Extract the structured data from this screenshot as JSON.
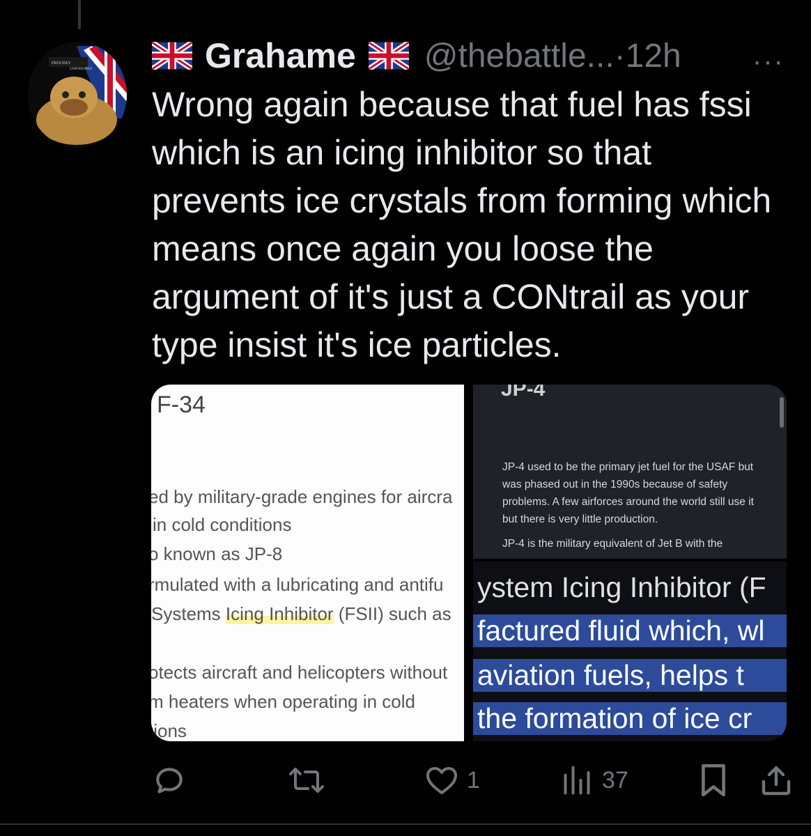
{
  "tweet": {
    "name": "Grahame",
    "handle": "@thebattle...",
    "separator": "·",
    "time": "12h",
    "more_label": "···",
    "text": "Wrong again because that fuel has fssi which is an icing inhibitor so that prevents ice crystals from forming which means once again you loose the argument of it's just a CONtrail as your type insist it's ice particles."
  },
  "avatar": {
    "top_text": "PROUDLY",
    "sub_text": "UNPOISONED"
  },
  "media": {
    "left": {
      "title": "F-34",
      "lines": [
        "ed by military-grade engines for aircra",
        "in cold conditions",
        "o known as JP-8",
        "rmulated with a lubricating and antifu",
        "Systems ",
        "Icing Inhibitor",
        " (FSII) such as",
        "otects aircraft and helicopters without",
        "m heaters when operating in cold",
        "tions"
      ]
    },
    "right_top": {
      "title": "JP-4",
      "para1": "JP-4 used to be the primary jet fuel for the USAF but was phased out in the 1990s because of safety problems. A few airforces around the world still use it but there is very little production.",
      "para2": "JP-4 is the military equivalent of Jet B with the"
    },
    "right_bottom": {
      "lines": [
        "ystem Icing Inhibitor (F",
        "factured fluid which, wl",
        "aviation fuels, helps t",
        "the formation of ice cr"
      ]
    }
  },
  "actions": {
    "reply_count": "",
    "retweet_count": "",
    "like_count": "1",
    "views_count": "37"
  },
  "colors": {
    "background": "#000000",
    "text": "#e7e9ea",
    "muted": "#71767b",
    "highlight_band": "#2c4b9b"
  }
}
